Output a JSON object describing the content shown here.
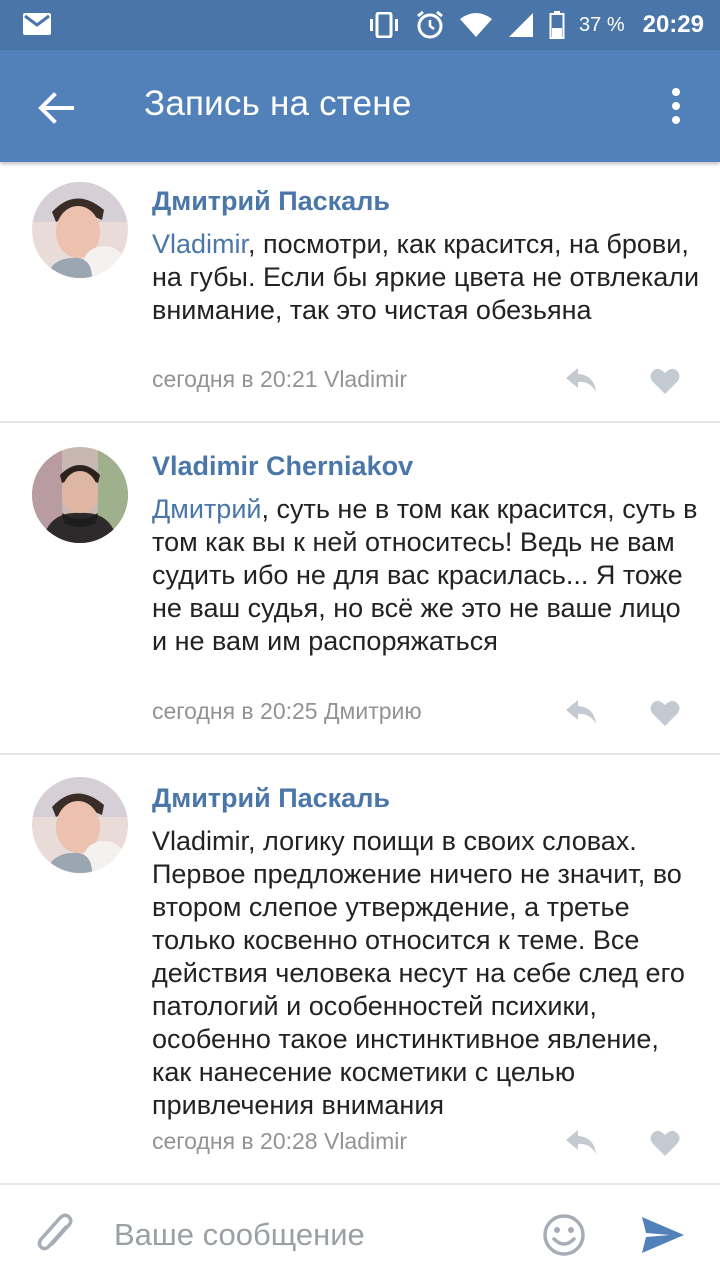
{
  "status_bar": {
    "battery": "37 %",
    "time": "20:29"
  },
  "app_bar": {
    "title": "Запись на стене"
  },
  "comments": [
    {
      "author": "Дмитрий Паскаль",
      "mention": "Vladimir",
      "text": ", посмотри, как красится, на брови, на губы. Если бы яркие цвета не отвлекали внимание, так это чистая обезьяна",
      "meta": "сегодня в 20:21 Vladimir"
    },
    {
      "author": "Vladimir Cherniakov",
      "mention": "Дмитрий",
      "text": ", суть не в том как красится, суть в том как вы к ней относитесь! Ведь не вам судить ибо не для вас красилась... Я тоже не ваш судья, но всё же это не ваше лицо и не вам им распоряжаться",
      "meta": "сегодня в 20:25 Дмитрию"
    },
    {
      "author": "Дмитрий Паскаль",
      "mention": "",
      "text": "Vladimir, логику поищи в своих словах. Первое предложение ничего не значит, во втором слепое утверждение, а третье только косвенно относится к теме. Все действия человека несут на себе след его патологий и особенностей психики, особенно такое инстинктивное явление, как нанесение косметики с целью привлечения внимания",
      "meta": "сегодня в 20:28 Vladimir"
    }
  ],
  "input": {
    "placeholder": "Ваше сообщение"
  },
  "colors": {
    "status_bar": "#4a75a9",
    "app_bar": "#5181b8",
    "link": "#4a76a8",
    "meta": "#939393"
  }
}
